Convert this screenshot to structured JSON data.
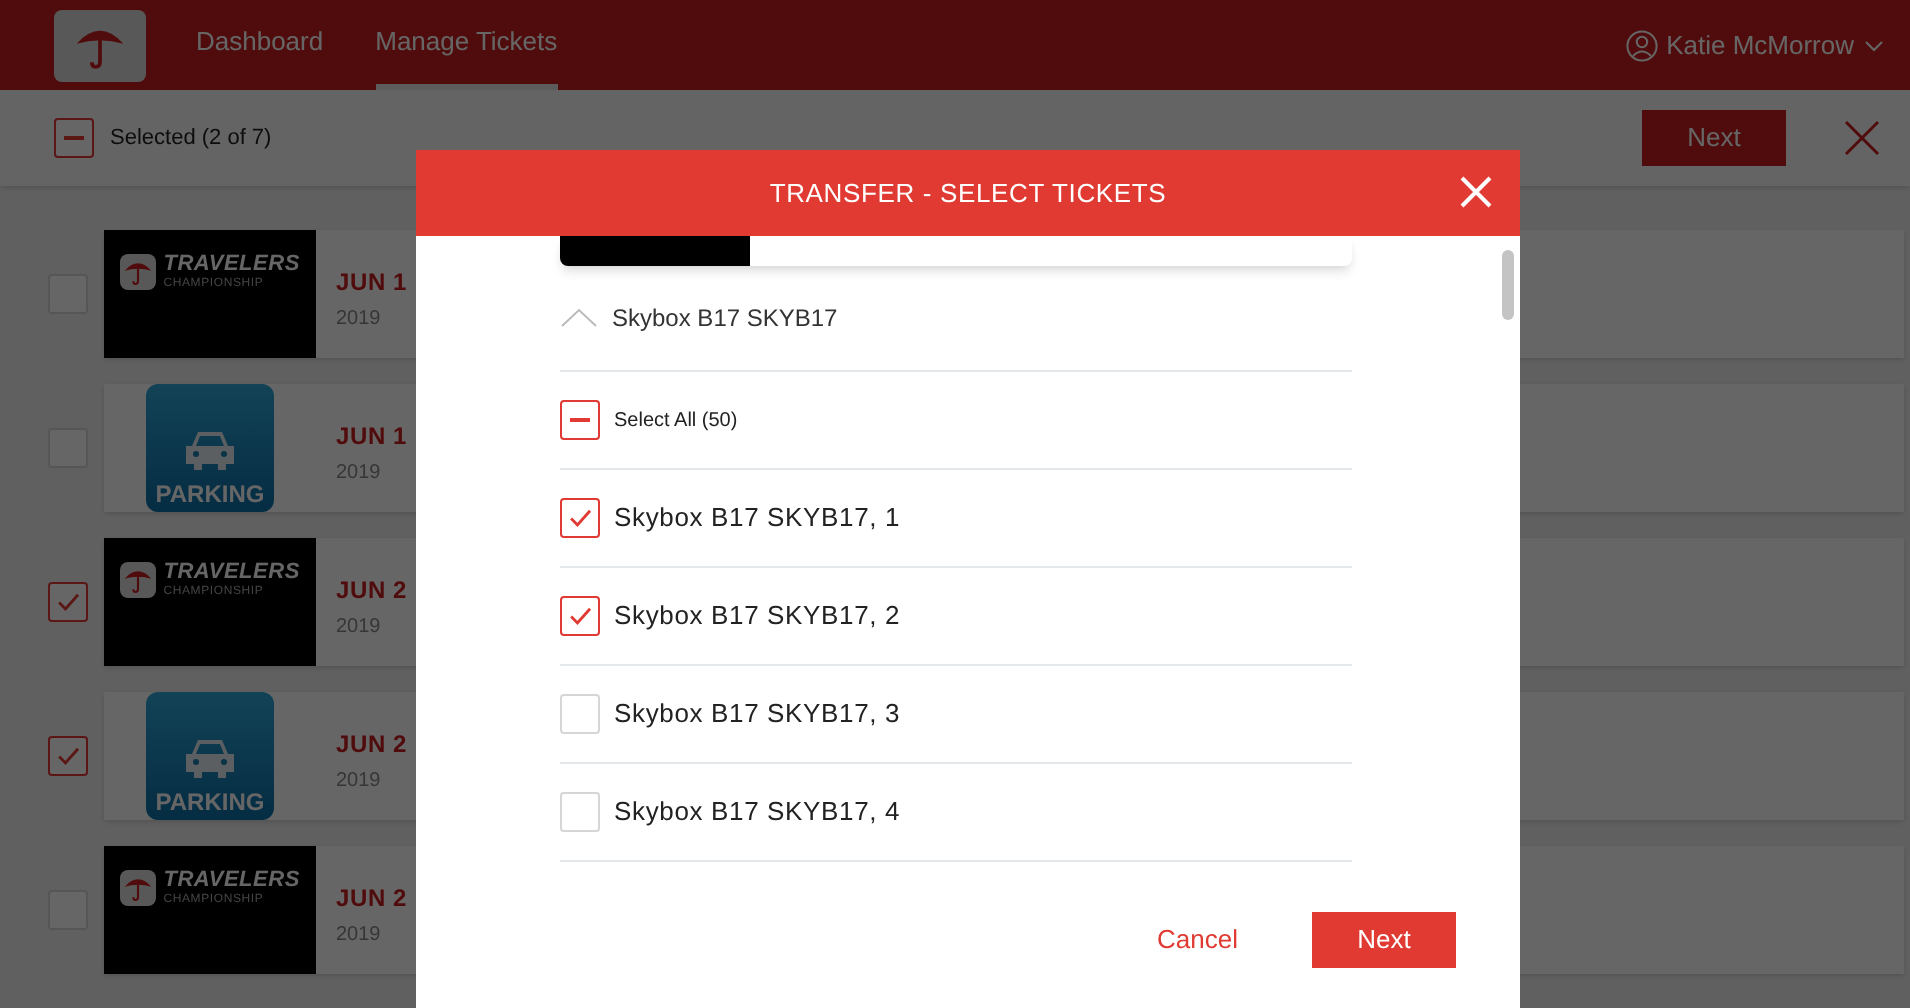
{
  "nav": {
    "items": [
      {
        "label": "Dashboard",
        "selected": false
      },
      {
        "label": "Manage Tickets",
        "selected": true
      }
    ],
    "user": "Katie McMorrow"
  },
  "toolbar": {
    "indeterminate": true,
    "selected_label": "Selected (2 of 7)",
    "next": "Next"
  },
  "tickets": [
    {
      "kind": "travelers",
      "logo_title": "TRAVELERS",
      "logo_subtitle": "CHAMPIONSHIP",
      "checked": false,
      "date": "JUN 1",
      "year": "2019"
    },
    {
      "kind": "parking",
      "logo_title": "PARKING",
      "checked": false,
      "date": "JUN 1",
      "year": "2019"
    },
    {
      "kind": "travelers",
      "logo_title": "TRAVELERS",
      "logo_subtitle": "CHAMPIONSHIP",
      "checked": true,
      "date": "JUN 2",
      "year": "2019"
    },
    {
      "kind": "parking",
      "logo_title": "PARKING",
      "checked": true,
      "date": "JUN 2",
      "year": "2019"
    },
    {
      "kind": "travelers",
      "logo_title": "TRAVELERS",
      "logo_subtitle": "CHAMPIONSHIP",
      "checked": false,
      "date": "JUN 2",
      "year": "2019"
    }
  ],
  "modal": {
    "title": "TRANSFER - SELECT TICKETS",
    "group": {
      "label": "Skybox B17 SKYB17",
      "expanded": true
    },
    "select_all": "Select All (50)",
    "select_all_indeterminate": true,
    "seats": [
      {
        "label": "Skybox B17 SKYB17, 1",
        "checked": true
      },
      {
        "label": "Skybox B17 SKYB17, 2",
        "checked": true
      },
      {
        "label": "Skybox B17 SKYB17, 3",
        "checked": false
      },
      {
        "label": "Skybox B17 SKYB17, 4",
        "checked": false
      }
    ],
    "cancel": "Cancel",
    "next": "Next"
  }
}
